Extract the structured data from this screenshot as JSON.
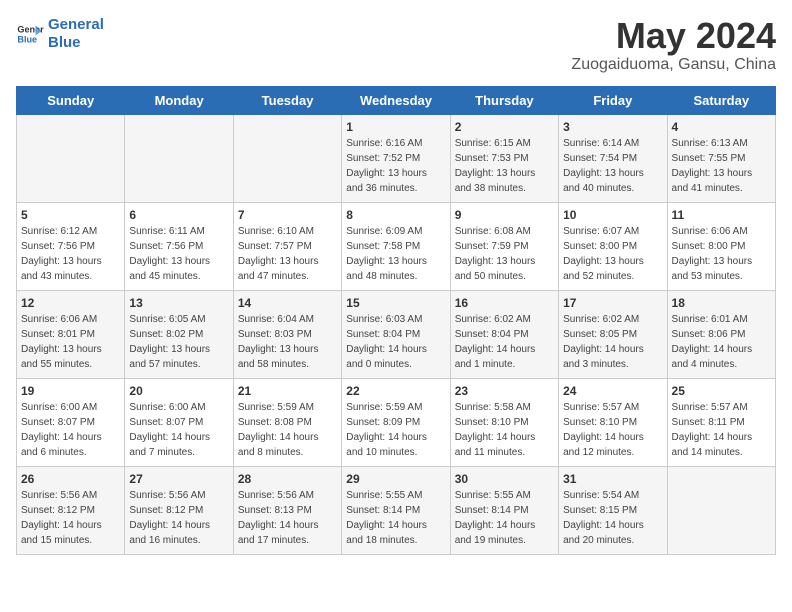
{
  "header": {
    "logo_line1": "General",
    "logo_line2": "Blue",
    "title": "May 2024",
    "subtitle": "Zuogaiduoma, Gansu, China"
  },
  "days_of_week": [
    "Sunday",
    "Monday",
    "Tuesday",
    "Wednesday",
    "Thursday",
    "Friday",
    "Saturday"
  ],
  "weeks": [
    {
      "days": [
        {
          "num": "",
          "info": ""
        },
        {
          "num": "",
          "info": ""
        },
        {
          "num": "",
          "info": ""
        },
        {
          "num": "1",
          "info": "Sunrise: 6:16 AM\nSunset: 7:52 PM\nDaylight: 13 hours\nand 36 minutes."
        },
        {
          "num": "2",
          "info": "Sunrise: 6:15 AM\nSunset: 7:53 PM\nDaylight: 13 hours\nand 38 minutes."
        },
        {
          "num": "3",
          "info": "Sunrise: 6:14 AM\nSunset: 7:54 PM\nDaylight: 13 hours\nand 40 minutes."
        },
        {
          "num": "4",
          "info": "Sunrise: 6:13 AM\nSunset: 7:55 PM\nDaylight: 13 hours\nand 41 minutes."
        }
      ]
    },
    {
      "days": [
        {
          "num": "5",
          "info": "Sunrise: 6:12 AM\nSunset: 7:56 PM\nDaylight: 13 hours\nand 43 minutes."
        },
        {
          "num": "6",
          "info": "Sunrise: 6:11 AM\nSunset: 7:56 PM\nDaylight: 13 hours\nand 45 minutes."
        },
        {
          "num": "7",
          "info": "Sunrise: 6:10 AM\nSunset: 7:57 PM\nDaylight: 13 hours\nand 47 minutes."
        },
        {
          "num": "8",
          "info": "Sunrise: 6:09 AM\nSunset: 7:58 PM\nDaylight: 13 hours\nand 48 minutes."
        },
        {
          "num": "9",
          "info": "Sunrise: 6:08 AM\nSunset: 7:59 PM\nDaylight: 13 hours\nand 50 minutes."
        },
        {
          "num": "10",
          "info": "Sunrise: 6:07 AM\nSunset: 8:00 PM\nDaylight: 13 hours\nand 52 minutes."
        },
        {
          "num": "11",
          "info": "Sunrise: 6:06 AM\nSunset: 8:00 PM\nDaylight: 13 hours\nand 53 minutes."
        }
      ]
    },
    {
      "days": [
        {
          "num": "12",
          "info": "Sunrise: 6:06 AM\nSunset: 8:01 PM\nDaylight: 13 hours\nand 55 minutes."
        },
        {
          "num": "13",
          "info": "Sunrise: 6:05 AM\nSunset: 8:02 PM\nDaylight: 13 hours\nand 57 minutes."
        },
        {
          "num": "14",
          "info": "Sunrise: 6:04 AM\nSunset: 8:03 PM\nDaylight: 13 hours\nand 58 minutes."
        },
        {
          "num": "15",
          "info": "Sunrise: 6:03 AM\nSunset: 8:04 PM\nDaylight: 14 hours\nand 0 minutes."
        },
        {
          "num": "16",
          "info": "Sunrise: 6:02 AM\nSunset: 8:04 PM\nDaylight: 14 hours\nand 1 minute."
        },
        {
          "num": "17",
          "info": "Sunrise: 6:02 AM\nSunset: 8:05 PM\nDaylight: 14 hours\nand 3 minutes."
        },
        {
          "num": "18",
          "info": "Sunrise: 6:01 AM\nSunset: 8:06 PM\nDaylight: 14 hours\nand 4 minutes."
        }
      ]
    },
    {
      "days": [
        {
          "num": "19",
          "info": "Sunrise: 6:00 AM\nSunset: 8:07 PM\nDaylight: 14 hours\nand 6 minutes."
        },
        {
          "num": "20",
          "info": "Sunrise: 6:00 AM\nSunset: 8:07 PM\nDaylight: 14 hours\nand 7 minutes."
        },
        {
          "num": "21",
          "info": "Sunrise: 5:59 AM\nSunset: 8:08 PM\nDaylight: 14 hours\nand 8 minutes."
        },
        {
          "num": "22",
          "info": "Sunrise: 5:59 AM\nSunset: 8:09 PM\nDaylight: 14 hours\nand 10 minutes."
        },
        {
          "num": "23",
          "info": "Sunrise: 5:58 AM\nSunset: 8:10 PM\nDaylight: 14 hours\nand 11 minutes."
        },
        {
          "num": "24",
          "info": "Sunrise: 5:57 AM\nSunset: 8:10 PM\nDaylight: 14 hours\nand 12 minutes."
        },
        {
          "num": "25",
          "info": "Sunrise: 5:57 AM\nSunset: 8:11 PM\nDaylight: 14 hours\nand 14 minutes."
        }
      ]
    },
    {
      "days": [
        {
          "num": "26",
          "info": "Sunrise: 5:56 AM\nSunset: 8:12 PM\nDaylight: 14 hours\nand 15 minutes."
        },
        {
          "num": "27",
          "info": "Sunrise: 5:56 AM\nSunset: 8:12 PM\nDaylight: 14 hours\nand 16 minutes."
        },
        {
          "num": "28",
          "info": "Sunrise: 5:56 AM\nSunset: 8:13 PM\nDaylight: 14 hours\nand 17 minutes."
        },
        {
          "num": "29",
          "info": "Sunrise: 5:55 AM\nSunset: 8:14 PM\nDaylight: 14 hours\nand 18 minutes."
        },
        {
          "num": "30",
          "info": "Sunrise: 5:55 AM\nSunset: 8:14 PM\nDaylight: 14 hours\nand 19 minutes."
        },
        {
          "num": "31",
          "info": "Sunrise: 5:54 AM\nSunset: 8:15 PM\nDaylight: 14 hours\nand 20 minutes."
        },
        {
          "num": "",
          "info": ""
        }
      ]
    }
  ]
}
